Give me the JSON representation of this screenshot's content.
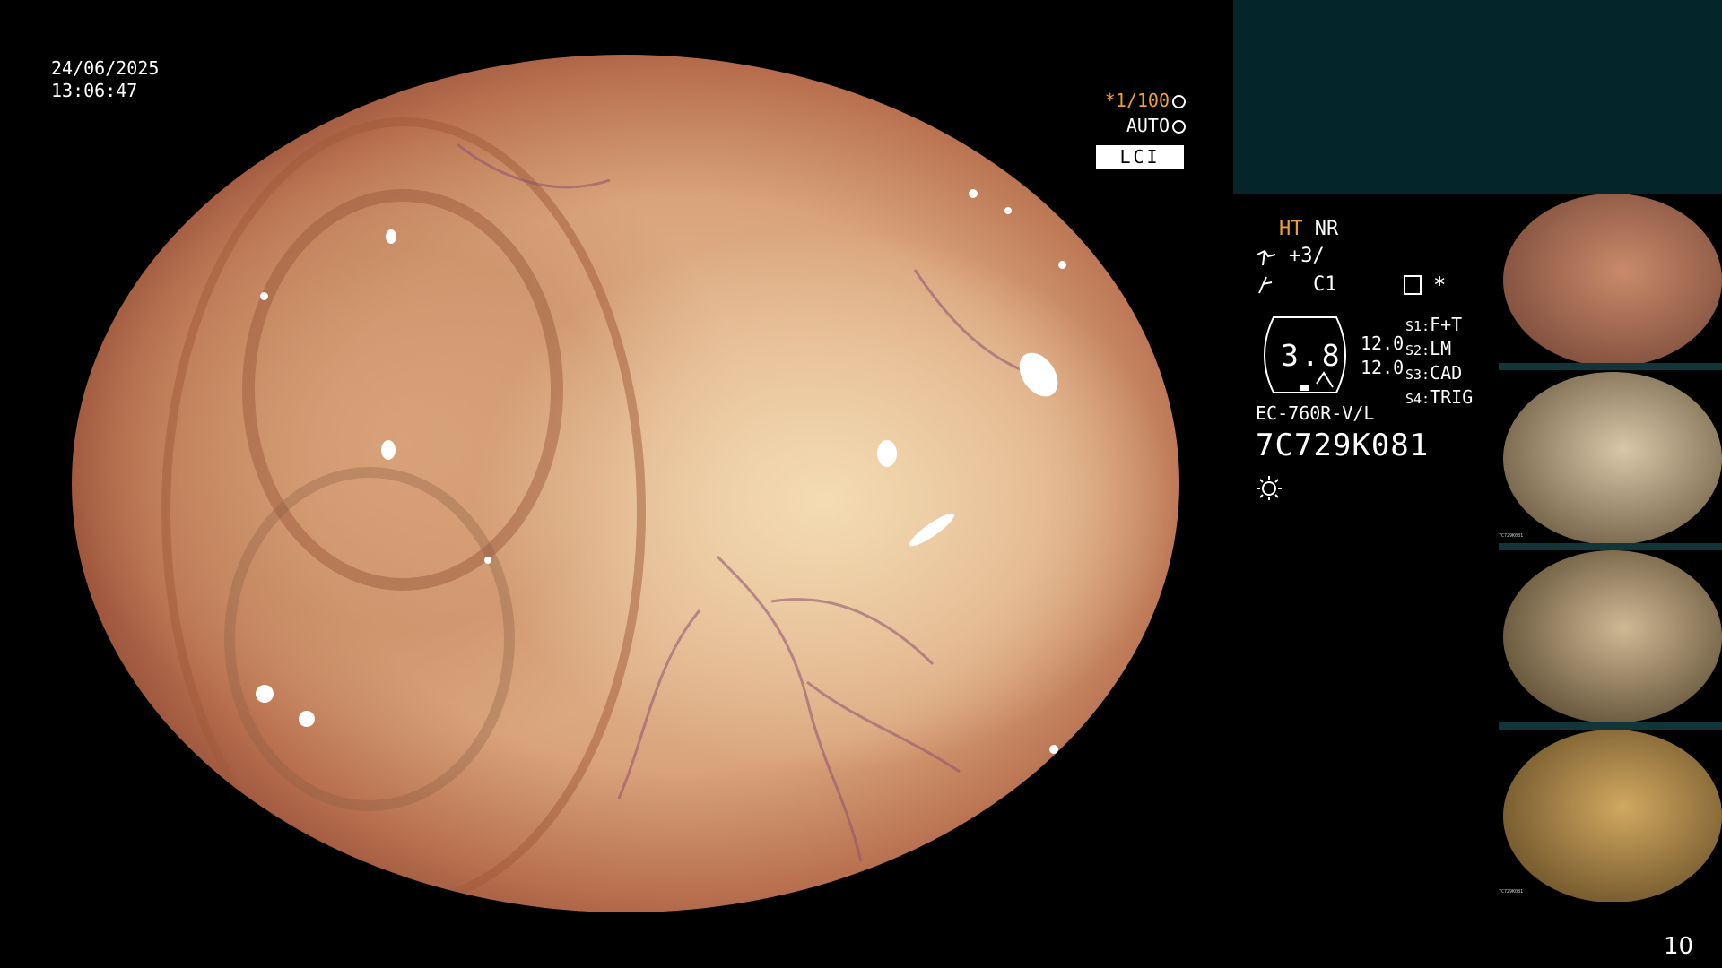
{
  "datetime": {
    "date": "24/06/2025",
    "time": "13:06:47"
  },
  "overlay": {
    "shutter": "*1/100",
    "shutter_icon": "aperture-icon",
    "iris": "AUTO",
    "iris_icon": "iris-icon",
    "mode": "LCI"
  },
  "info": {
    "ht": "HT",
    "nr": "NR",
    "enhance": "+3/",
    "color": "C1",
    "gauge_value": "3.8",
    "gauge_right": [
      "12.0",
      "12.0"
    ],
    "scope_keys": [
      "S1:",
      "S2:",
      "S3:",
      "S4:"
    ],
    "scope_values": [
      "F+T",
      "LM",
      "CAD",
      "TRIG"
    ],
    "star": "*",
    "model": "EC-760R-V/L",
    "serial": "7C729K081"
  },
  "thumbnails": [
    {
      "tint": "#c98a6a",
      "tint2": "#7a4a3a"
    },
    {
      "tint": "#d8c8a8",
      "tint2": "#6b5a40"
    },
    {
      "tint": "#cfb894",
      "tint2": "#5a4a30"
    },
    {
      "tint": "#d0a860",
      "tint2": "#6a5028"
    }
  ],
  "thumb_text": [
    "24/06/2025",
    "7C729K081"
  ],
  "page_number": "10",
  "colors": {
    "accent": "#f0a030",
    "panel": "#04252a",
    "background": "#000000"
  }
}
